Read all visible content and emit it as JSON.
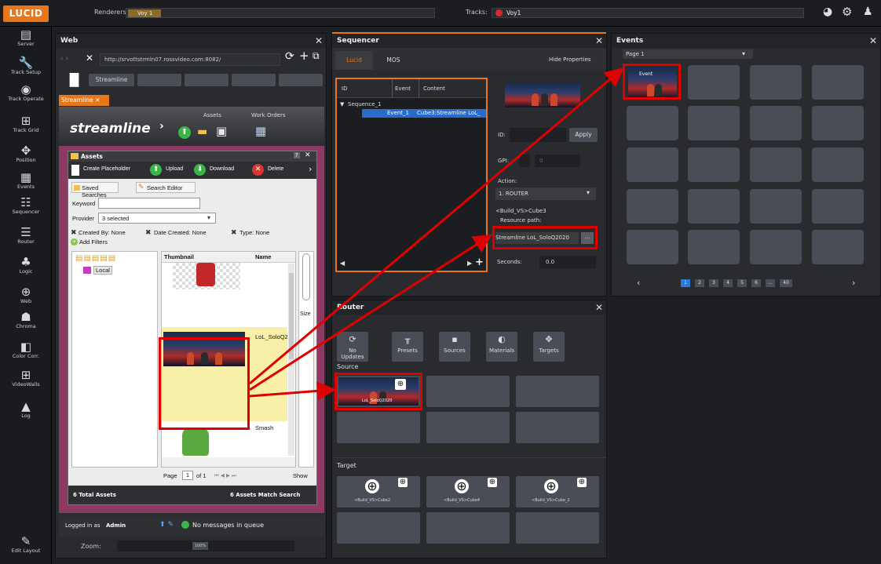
{
  "topbar": {
    "logo": "LUCID",
    "renderers_label": "Renderers:",
    "renderer_value": "Voy 1",
    "tracks_label": "Tracks:",
    "track_value": "Voy1"
  },
  "nav": [
    {
      "label": "Server",
      "icon": "server-icon"
    },
    {
      "label": "Track Setup",
      "icon": "wrench-icon"
    },
    {
      "label": "Track Operate",
      "icon": "joystick-icon"
    },
    {
      "label": "Track Grid",
      "icon": "grid-icon"
    },
    {
      "label": "Position",
      "icon": "move-icon"
    },
    {
      "label": "Events",
      "icon": "events-icon"
    },
    {
      "label": "Sequencer",
      "icon": "sequencer-icon"
    },
    {
      "label": "Router",
      "icon": "router-icon"
    },
    {
      "label": "Logic",
      "icon": "logic-icon"
    },
    {
      "label": "Web",
      "icon": "globe-icon"
    },
    {
      "label": "Chroma",
      "icon": "chroma-icon"
    },
    {
      "label": "Color Corr.",
      "icon": "color-icon"
    },
    {
      "label": "VideoWalls",
      "icon": "videowall-icon"
    },
    {
      "label": "Log",
      "icon": "log-icon"
    }
  ],
  "nav_bottom": {
    "label": "Edit Layout"
  },
  "web": {
    "title": "Web",
    "url": "http://srvottstrmln07.rossvideo.com:8082/",
    "tab_button": "Streamline",
    "tab": "Streamline",
    "header": {
      "logo": "streamline",
      "assets_label": "Assets",
      "work_orders_label": "Work Orders"
    },
    "assets": {
      "title": "Assets",
      "toolbar": [
        "Create Placeholder",
        "Upload",
        "Download",
        "Delete"
      ],
      "saved_searches": "Saved Searches",
      "search_editor": "Search Editor",
      "keyword_label": "Keyword",
      "provider_label": "Provider",
      "provider_value": "3 selected",
      "filters": [
        "Created By: None",
        "Date Created: None",
        "Type: None"
      ],
      "add_filters": "Add Filters",
      "tree_item": "Local",
      "col_thumbnail": "Thumbnail",
      "col_name": "Name",
      "rows": [
        {
          "name": ""
        },
        {
          "name": "LoL_SoloQ2"
        },
        {
          "name": "Smash"
        }
      ],
      "side_label": "Size",
      "page_label": "Page",
      "page_value": "1",
      "page_of": "of 1",
      "show_label": "Show",
      "total": "6 Total Assets",
      "match": "6 Assets Match Search"
    },
    "footer": {
      "logged_in": "Logged in as",
      "user": "Admin",
      "messages": "No messages in queue"
    },
    "zoom_label": "Zoom:",
    "zoom_value": "100%"
  },
  "sequencer": {
    "title": "Sequencer",
    "tabs": [
      "Lucid",
      "MOS"
    ],
    "hide_properties": "Hide Properties",
    "cols": [
      "ID",
      "Event",
      "Content"
    ],
    "tree_root": "Sequence_1",
    "row_event": "Event_1",
    "row_content": "Cube3:Streamline LoL_",
    "id_label": "ID:",
    "apply": "Apply",
    "gpi_label": "GPI:",
    "gpi_value": "0",
    "action_label": "Action:",
    "action_value": "1. ROUTER",
    "build_text": "<Build_VS>Cube3",
    "resource_label": "Resource path:",
    "resource_value": "Streamline LoL_SoloQ2020",
    "dots": "...",
    "seconds_label": "Seconds:",
    "seconds_value": "0.0"
  },
  "router": {
    "title": "Router",
    "buttons": [
      "No Updates",
      "Presets",
      "Sources",
      "Materials",
      "Targets"
    ],
    "source_label": "Source",
    "source_item": "LoL_SoloQ2020",
    "target_label": "Target",
    "targets": [
      "<Build_VS>Cube2",
      "<Build_VS>Cube4",
      "<Build_VS>Cube_2"
    ]
  },
  "events": {
    "title": "Events",
    "page": "Page 1",
    "pages": [
      "1",
      "2",
      "3",
      "4",
      "5",
      "6",
      "...",
      "40"
    ],
    "event_label": "Event"
  },
  "colors": {
    "accent": "#e8761b",
    "highlight": "#e10000"
  }
}
